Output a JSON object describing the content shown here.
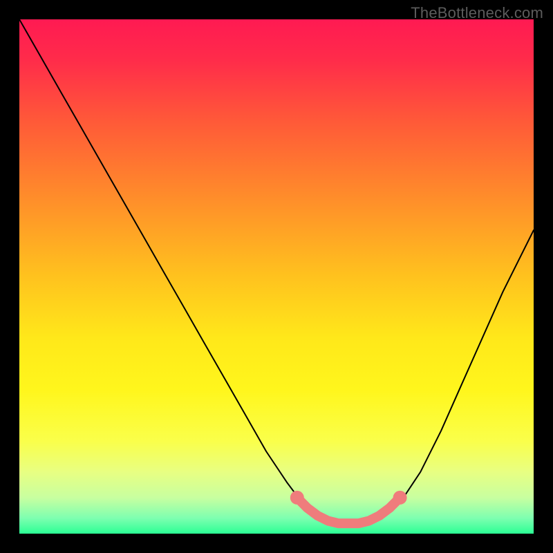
{
  "watermark": "TheBottleneck.com",
  "chart_data": {
    "type": "line",
    "title": "",
    "xlabel": "",
    "ylabel": "",
    "xlim": [
      0,
      100
    ],
    "ylim": [
      0,
      100
    ],
    "grid": false,
    "legend": false,
    "background_gradient": {
      "stops": [
        {
          "offset": 0.0,
          "color": "#ff1a52"
        },
        {
          "offset": 0.08,
          "color": "#ff2c4a"
        },
        {
          "offset": 0.2,
          "color": "#ff5a38"
        },
        {
          "offset": 0.35,
          "color": "#ff8e2a"
        },
        {
          "offset": 0.5,
          "color": "#ffc21e"
        },
        {
          "offset": 0.62,
          "color": "#ffe81a"
        },
        {
          "offset": 0.72,
          "color": "#fff61c"
        },
        {
          "offset": 0.82,
          "color": "#faff4a"
        },
        {
          "offset": 0.88,
          "color": "#e8ff82"
        },
        {
          "offset": 0.93,
          "color": "#c8ffa0"
        },
        {
          "offset": 0.97,
          "color": "#7dffb0"
        },
        {
          "offset": 1.0,
          "color": "#2bff94"
        }
      ]
    },
    "curve": {
      "x": [
        0,
        4,
        8,
        12,
        16,
        20,
        24,
        28,
        32,
        36,
        40,
        44,
        48,
        52,
        55,
        58,
        61,
        64,
        67,
        70,
        74,
        78,
        82,
        86,
        90,
        94,
        98,
        100
      ],
      "y": [
        100,
        93,
        86,
        79,
        72,
        65,
        58,
        51,
        44,
        37,
        30,
        23,
        16,
        10,
        6,
        3,
        2,
        2,
        2,
        3,
        6,
        12,
        20,
        29,
        38,
        47,
        55,
        59
      ]
    },
    "highlight_segment": {
      "color": "#ef7c7c",
      "points_x": [
        54,
        56,
        58,
        60,
        62,
        64,
        66,
        68,
        70,
        72,
        74
      ],
      "points_y": [
        7,
        5,
        3.5,
        2.5,
        2,
        2,
        2,
        2.5,
        3.5,
        5,
        7
      ]
    }
  }
}
